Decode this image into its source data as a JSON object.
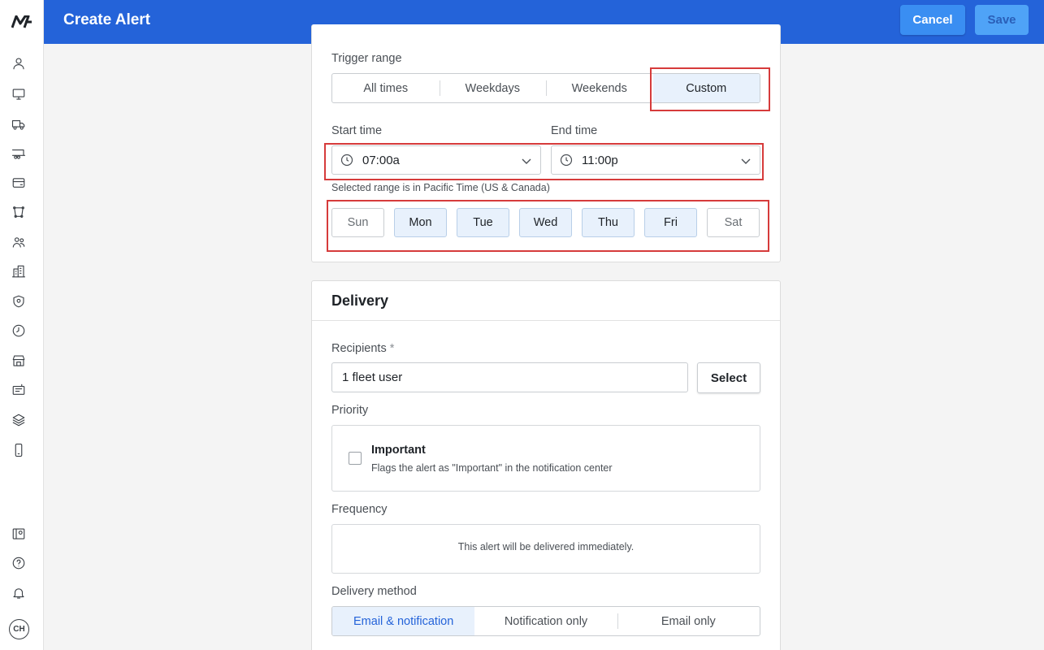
{
  "app": {
    "logo_text": "M"
  },
  "header": {
    "title": "Create Alert",
    "cancel_label": "Cancel",
    "save_label": "Save"
  },
  "sidebar": {
    "items": [
      {
        "icon": "user-icon"
      },
      {
        "icon": "monitor-icon"
      },
      {
        "icon": "truck-icon"
      },
      {
        "icon": "trailer-icon"
      },
      {
        "icon": "card-icon"
      },
      {
        "icon": "route-icon"
      },
      {
        "icon": "users-icon"
      },
      {
        "icon": "building-icon"
      },
      {
        "icon": "shield-icon"
      },
      {
        "icon": "clock-icon"
      },
      {
        "icon": "store-icon"
      },
      {
        "icon": "ticket-icon"
      },
      {
        "icon": "layers-icon"
      },
      {
        "icon": "phone-icon"
      }
    ],
    "bottom": [
      {
        "icon": "map-pin-icon"
      },
      {
        "icon": "help-icon"
      },
      {
        "icon": "bell-icon"
      }
    ],
    "avatar_initials": "CH"
  },
  "trigger": {
    "range_label": "Trigger range",
    "options": [
      "All times",
      "Weekdays",
      "Weekends",
      "Custom"
    ],
    "selected": "Custom",
    "start_label": "Start time",
    "end_label": "End time",
    "start_value": "07:00a",
    "end_value": "11:00p",
    "timezone_note": "Selected range is in Pacific Time (US & Canada)",
    "days": [
      {
        "label": "Sun",
        "selected": false
      },
      {
        "label": "Mon",
        "selected": true
      },
      {
        "label": "Tue",
        "selected": true
      },
      {
        "label": "Wed",
        "selected": true
      },
      {
        "label": "Thu",
        "selected": true
      },
      {
        "label": "Fri",
        "selected": true
      },
      {
        "label": "Sat",
        "selected": false
      }
    ]
  },
  "delivery": {
    "title": "Delivery",
    "recipients_label": "Recipients",
    "recipients_required": "*",
    "recipients_value": "1 fleet user",
    "select_label": "Select",
    "priority_label": "Priority",
    "important_title": "Important",
    "important_desc": "Flags the alert as \"Important\" in the notification center",
    "important_checked": false,
    "frequency_label": "Frequency",
    "frequency_text": "This alert will be delivered immediately.",
    "method_label": "Delivery method",
    "methods": [
      "Email & notification",
      "Notification only",
      "Email only"
    ],
    "method_selected": "Email & notification"
  },
  "colors": {
    "header": "#2463d9",
    "highlight": "#d63b3b",
    "selected_bg": "#e8f1fc"
  }
}
